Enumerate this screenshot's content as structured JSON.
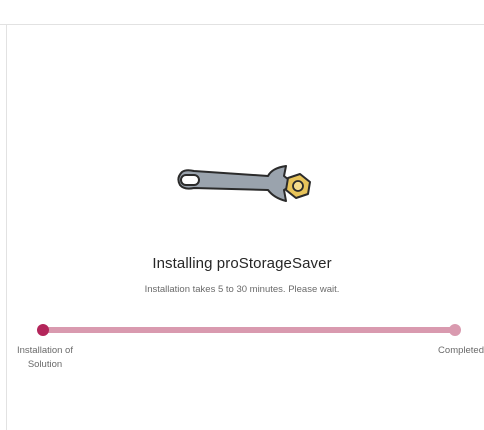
{
  "install": {
    "title": "Installing proStorageSaver",
    "subtitle": "Installation takes 5 to 30 minutes. Please wait.",
    "illustration_icon": "wrench-and-nut-icon"
  },
  "progress": {
    "start_label_line1": "Installation of",
    "start_label_line2": "Solution",
    "end_label": "Completed",
    "current_step": 1,
    "total_steps": 2
  },
  "colors": {
    "accent": "#b3255a",
    "track": "#d99aaf",
    "wrench": "#9aa3ad",
    "nut": "#e8c45a"
  }
}
